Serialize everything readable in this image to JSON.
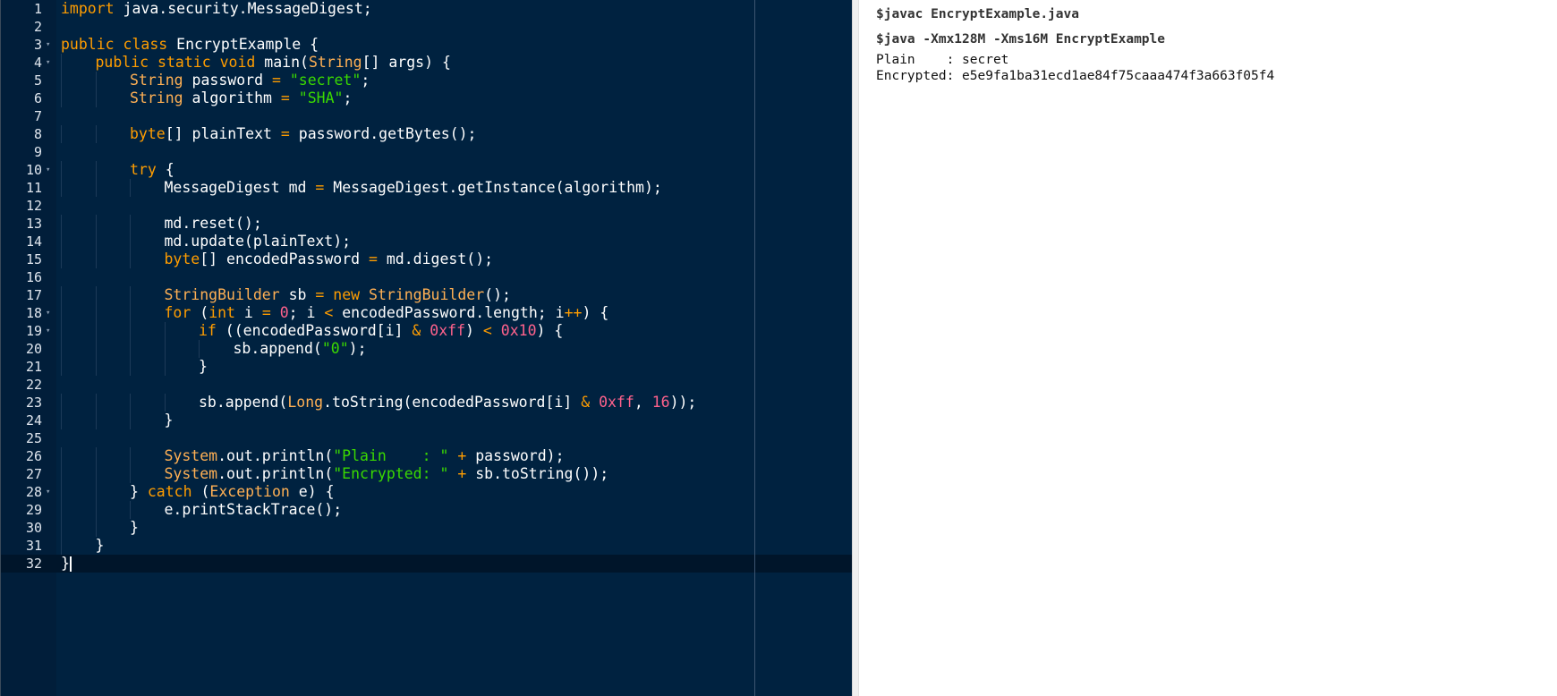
{
  "editor": {
    "cursor_line": 32,
    "lines": [
      {
        "n": "1",
        "indent": 0,
        "fold": false,
        "tokens": [
          [
            "kw",
            "import"
          ],
          [
            "pl",
            " java.security.MessageDigest;"
          ]
        ]
      },
      {
        "n": "2",
        "indent": 0,
        "fold": false,
        "tokens": []
      },
      {
        "n": "3",
        "indent": 0,
        "fold": true,
        "tokens": [
          [
            "kw",
            "public"
          ],
          [
            "pl",
            " "
          ],
          [
            "kw",
            "class"
          ],
          [
            "pl",
            " EncryptExample {"
          ]
        ]
      },
      {
        "n": "4",
        "indent": 1,
        "fold": true,
        "tokens": [
          [
            "kw",
            "public"
          ],
          [
            "pl",
            " "
          ],
          [
            "kw",
            "static"
          ],
          [
            "pl",
            " "
          ],
          [
            "kw",
            "void"
          ],
          [
            "pl",
            " main("
          ],
          [
            "ty",
            "String"
          ],
          [
            "pl",
            "[] args) {"
          ]
        ]
      },
      {
        "n": "5",
        "indent": 2,
        "fold": false,
        "tokens": [
          [
            "ty",
            "String"
          ],
          [
            "pl",
            " password "
          ],
          [
            "op",
            "="
          ],
          [
            "pl",
            " "
          ],
          [
            "st",
            "\"secret\""
          ],
          [
            "pl",
            ";"
          ]
        ]
      },
      {
        "n": "6",
        "indent": 2,
        "fold": false,
        "tokens": [
          [
            "ty",
            "String"
          ],
          [
            "pl",
            " algorithm "
          ],
          [
            "op",
            "="
          ],
          [
            "pl",
            " "
          ],
          [
            "st",
            "\"SHA\""
          ],
          [
            "pl",
            ";"
          ]
        ]
      },
      {
        "n": "7",
        "indent": 0,
        "fold": false,
        "tokens": []
      },
      {
        "n": "8",
        "indent": 2,
        "fold": false,
        "tokens": [
          [
            "kw",
            "byte"
          ],
          [
            "pl",
            "[] plainText "
          ],
          [
            "op",
            "="
          ],
          [
            "pl",
            " password.getBytes();"
          ]
        ]
      },
      {
        "n": "9",
        "indent": 0,
        "fold": false,
        "tokens": []
      },
      {
        "n": "10",
        "indent": 2,
        "fold": true,
        "tokens": [
          [
            "kw",
            "try"
          ],
          [
            "pl",
            " {"
          ]
        ]
      },
      {
        "n": "11",
        "indent": 3,
        "fold": false,
        "tokens": [
          [
            "pl",
            "MessageDigest md "
          ],
          [
            "op",
            "="
          ],
          [
            "pl",
            " MessageDigest.getInstance(algorithm);"
          ]
        ]
      },
      {
        "n": "12",
        "indent": 0,
        "fold": false,
        "tokens": []
      },
      {
        "n": "13",
        "indent": 3,
        "fold": false,
        "tokens": [
          [
            "pl",
            "md.reset();"
          ]
        ]
      },
      {
        "n": "14",
        "indent": 3,
        "fold": false,
        "tokens": [
          [
            "pl",
            "md.update(plainText);"
          ]
        ]
      },
      {
        "n": "15",
        "indent": 3,
        "fold": false,
        "tokens": [
          [
            "kw",
            "byte"
          ],
          [
            "pl",
            "[] encodedPassword "
          ],
          [
            "op",
            "="
          ],
          [
            "pl",
            " md.digest();"
          ]
        ]
      },
      {
        "n": "16",
        "indent": 0,
        "fold": false,
        "tokens": []
      },
      {
        "n": "17",
        "indent": 3,
        "fold": false,
        "tokens": [
          [
            "ty",
            "StringBuilder"
          ],
          [
            "pl",
            " sb "
          ],
          [
            "op",
            "="
          ],
          [
            "pl",
            " "
          ],
          [
            "kw",
            "new"
          ],
          [
            "pl",
            " "
          ],
          [
            "ty",
            "StringBuilder"
          ],
          [
            "pl",
            "();"
          ]
        ]
      },
      {
        "n": "18",
        "indent": 3,
        "fold": true,
        "tokens": [
          [
            "kw",
            "for"
          ],
          [
            "pl",
            " ("
          ],
          [
            "kw",
            "int"
          ],
          [
            "pl",
            " i "
          ],
          [
            "op",
            "="
          ],
          [
            "pl",
            " "
          ],
          [
            "num",
            "0"
          ],
          [
            "pl",
            "; i "
          ],
          [
            "op",
            "<"
          ],
          [
            "pl",
            " encodedPassword.length; i"
          ],
          [
            "op",
            "++"
          ],
          [
            "pl",
            ") {"
          ]
        ]
      },
      {
        "n": "19",
        "indent": 4,
        "fold": true,
        "tokens": [
          [
            "kw",
            "if"
          ],
          [
            "pl",
            " ((encodedPassword[i] "
          ],
          [
            "op",
            "&"
          ],
          [
            "pl",
            " "
          ],
          [
            "num",
            "0xff"
          ],
          [
            "pl",
            ") "
          ],
          [
            "op",
            "<"
          ],
          [
            "pl",
            " "
          ],
          [
            "num",
            "0x10"
          ],
          [
            "pl",
            ") {"
          ]
        ]
      },
      {
        "n": "20",
        "indent": 5,
        "fold": false,
        "tokens": [
          [
            "pl",
            "sb.append("
          ],
          [
            "st",
            "\"0\""
          ],
          [
            "pl",
            ");"
          ]
        ]
      },
      {
        "n": "21",
        "indent": 4,
        "fold": false,
        "tokens": [
          [
            "pl",
            "}"
          ]
        ]
      },
      {
        "n": "22",
        "indent": 0,
        "fold": false,
        "tokens": []
      },
      {
        "n": "23",
        "indent": 4,
        "fold": false,
        "tokens": [
          [
            "pl",
            "sb.append("
          ],
          [
            "ty",
            "Long"
          ],
          [
            "pl",
            ".toString(encodedPassword[i] "
          ],
          [
            "op",
            "&"
          ],
          [
            "pl",
            " "
          ],
          [
            "num",
            "0xff"
          ],
          [
            "pl",
            ", "
          ],
          [
            "num",
            "16"
          ],
          [
            "pl",
            "));"
          ]
        ]
      },
      {
        "n": "24",
        "indent": 3,
        "fold": false,
        "tokens": [
          [
            "pl",
            "}"
          ]
        ]
      },
      {
        "n": "25",
        "indent": 0,
        "fold": false,
        "tokens": []
      },
      {
        "n": "26",
        "indent": 3,
        "fold": false,
        "tokens": [
          [
            "ty",
            "System"
          ],
          [
            "pl",
            ".out.println("
          ],
          [
            "st",
            "\"Plain    : \""
          ],
          [
            "pl",
            " "
          ],
          [
            "op",
            "+"
          ],
          [
            "pl",
            " password);"
          ]
        ]
      },
      {
        "n": "27",
        "indent": 3,
        "fold": false,
        "tokens": [
          [
            "ty",
            "System"
          ],
          [
            "pl",
            ".out.println("
          ],
          [
            "st",
            "\"Encrypted: \""
          ],
          [
            "pl",
            " "
          ],
          [
            "op",
            "+"
          ],
          [
            "pl",
            " sb.toString());"
          ]
        ]
      },
      {
        "n": "28",
        "indent": 2,
        "fold": true,
        "tokens": [
          [
            "pl",
            "} "
          ],
          [
            "kw",
            "catch"
          ],
          [
            "pl",
            " ("
          ],
          [
            "ty",
            "Exception"
          ],
          [
            "pl",
            " e) {"
          ]
        ]
      },
      {
        "n": "29",
        "indent": 3,
        "fold": false,
        "tokens": [
          [
            "pl",
            "e.printStackTrace();"
          ]
        ]
      },
      {
        "n": "30",
        "indent": 2,
        "fold": false,
        "tokens": [
          [
            "pl",
            "}"
          ]
        ]
      },
      {
        "n": "31",
        "indent": 1,
        "fold": false,
        "tokens": [
          [
            "pl",
            "}"
          ]
        ]
      },
      {
        "n": "32",
        "indent": 0,
        "fold": false,
        "tokens": [
          [
            "pl",
            "}"
          ]
        ]
      }
    ]
  },
  "output": {
    "compile_cmd": "$javac EncryptExample.java",
    "run_cmd": "$java -Xmx128M -Xms16M EncryptExample",
    "result_lines": [
      "Plain    : secret",
      "Encrypted: e5e9fa1ba31ecd1ae84f75caaa474f3a663f05f4"
    ]
  },
  "colors": {
    "editor_bg": "#002240",
    "keyword": "#ff9d00",
    "string": "#3ad900",
    "number": "#ff628c",
    "type": "#ffb054"
  }
}
